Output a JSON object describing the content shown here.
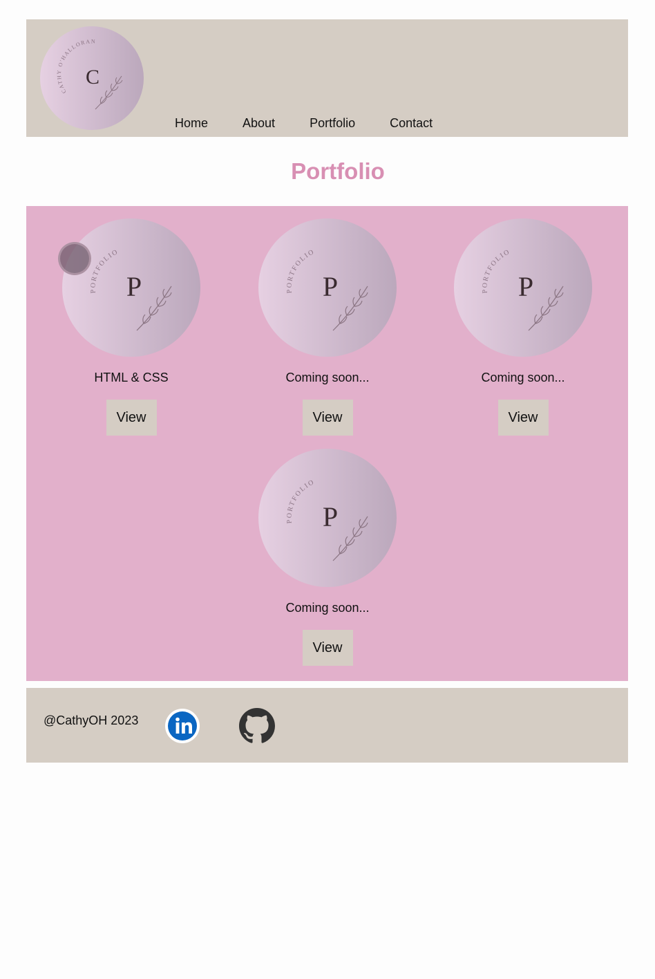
{
  "header": {
    "logo_initial": "C",
    "logo_text": "CATHY O'HALLORAN",
    "nav": [
      {
        "label": "Home"
      },
      {
        "label": "About"
      },
      {
        "label": "Portfolio"
      },
      {
        "label": "Contact"
      }
    ]
  },
  "main": {
    "title": "Portfolio",
    "thumb_initial": "P",
    "thumb_text": "PORTFOLIO",
    "projects": [
      {
        "caption": "HTML & CSS",
        "button": "View"
      },
      {
        "caption": "Coming soon...",
        "button": "View"
      },
      {
        "caption": "Coming soon...",
        "button": "View"
      },
      {
        "caption": "Coming soon...",
        "button": "View"
      }
    ]
  },
  "footer": {
    "copyright": "@CathyOH 2023",
    "social": [
      {
        "icon": "linkedin-icon",
        "brand_color": "#0a66c2"
      },
      {
        "icon": "github-icon",
        "brand_color": "#333333"
      }
    ]
  },
  "colors": {
    "header_bg": "#d5cdc4",
    "panel_bg": "#e2b0cb",
    "title": "#d88fb3",
    "button_bg": "#d5cdc4"
  }
}
